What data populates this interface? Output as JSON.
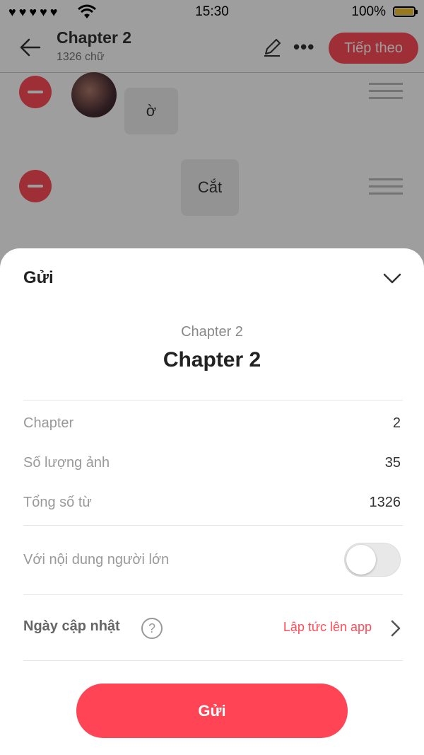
{
  "status_bar": {
    "time": "15:30",
    "battery": "100%",
    "battery_level": 1.0,
    "signal_icon": "signal-dots-icon",
    "wifi_icon": "wifi-icon",
    "battery_color": "#f5c330"
  },
  "nav": {
    "title": "Chapter 2",
    "subtitle": "1326 chữ",
    "next_label": "Tiếp theo",
    "back_icon": "arrow-left-icon",
    "edit_icon": "pencil-icon",
    "more_icon": "more-horizontal-icon",
    "more_glyph": "•••"
  },
  "content": {
    "items": [
      {
        "type": "image",
        "text": "ờ"
      },
      {
        "type": "text",
        "text": "Cắt"
      }
    ]
  },
  "sheet": {
    "title": "Gửi",
    "collapse_icon": "chevron-down-icon",
    "sub_title": "Chapter 2",
    "main_title": "Chapter 2",
    "info": [
      {
        "label": "Chapter",
        "value": "2"
      },
      {
        "label": "Số lượng ảnh",
        "value": "35"
      },
      {
        "label": "Tổng số từ",
        "value": "1326"
      }
    ],
    "adult": {
      "label": "Với nội dung người lớn",
      "enabled": false
    },
    "update": {
      "label": "Ngày cập nhật",
      "help_glyph": "?",
      "value": "Lập tức lên app",
      "arrow_icon": "chevron-right-icon"
    },
    "submit_label": "Gửi"
  },
  "colors": {
    "accent": "#ff4d58",
    "overlay": "rgba(0,0,0,0.38)"
  }
}
